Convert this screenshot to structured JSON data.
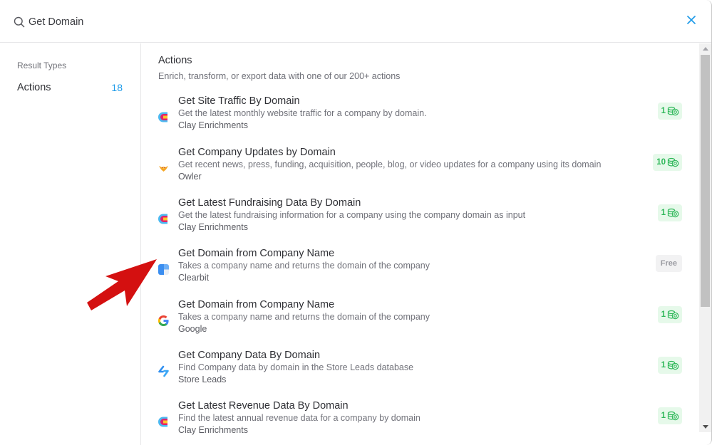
{
  "search": {
    "value": "Get Domain",
    "icon": "search-icon",
    "close_icon": "close-icon"
  },
  "sidebar": {
    "heading": "Result Types",
    "items": [
      {
        "label": "Actions",
        "count": "18"
      }
    ]
  },
  "main": {
    "section_title": "Actions",
    "section_subtitle": "Enrich, transform, or export data with one of our 200+ actions",
    "actions": [
      {
        "title": "Get Site Traffic By Domain",
        "description": "Get the latest monthly website traffic for a company by domain.",
        "provider": "Clay Enrichments",
        "icon": "clay-logo-icon",
        "cost": "1",
        "cost_type": "credits"
      },
      {
        "title": "Get Company Updates by Domain",
        "description": "Get recent news, press, funding, acquisition, people, blog, or video updates for a company using its domain",
        "provider": "Owler",
        "icon": "owler-logo-icon",
        "cost": "10",
        "cost_type": "credits"
      },
      {
        "title": "Get Latest Fundraising Data By Domain",
        "description": "Get the latest fundraising information for a company using the company domain as input",
        "provider": "Clay Enrichments",
        "icon": "clay-logo-icon",
        "cost": "1",
        "cost_type": "credits"
      },
      {
        "title": "Get Domain from Company Name",
        "description": "Takes a company name and returns the domain of the company",
        "provider": "Clearbit",
        "icon": "clearbit-logo-icon",
        "cost": "Free",
        "cost_type": "free"
      },
      {
        "title": "Get Domain from Company Name",
        "description": "Takes a company name and returns the domain of the company",
        "provider": "Google",
        "icon": "google-logo-icon",
        "cost": "1",
        "cost_type": "credits"
      },
      {
        "title": "Get Company Data By Domain",
        "description": "Find Company data by domain in the Store Leads database",
        "provider": "Store Leads",
        "icon": "storeleads-logo-icon",
        "cost": "1",
        "cost_type": "credits"
      },
      {
        "title": "Get Latest Revenue Data By Domain",
        "description": "Find the latest annual revenue data for a company by domain",
        "provider": "Clay Enrichments",
        "icon": "clay-logo-icon",
        "cost": "1",
        "cost_type": "credits"
      }
    ]
  },
  "colors": {
    "accent": "#1e9be9",
    "credit_badge_bg": "#e6f9ea",
    "credit_badge_text": "#2fb85a",
    "free_badge_bg": "#f2f2f3",
    "annotation_arrow": "#d41010"
  },
  "annotation": {
    "icon": "red-arrow-icon",
    "points_to": "Get Domain from Company Name (Clearbit)"
  }
}
